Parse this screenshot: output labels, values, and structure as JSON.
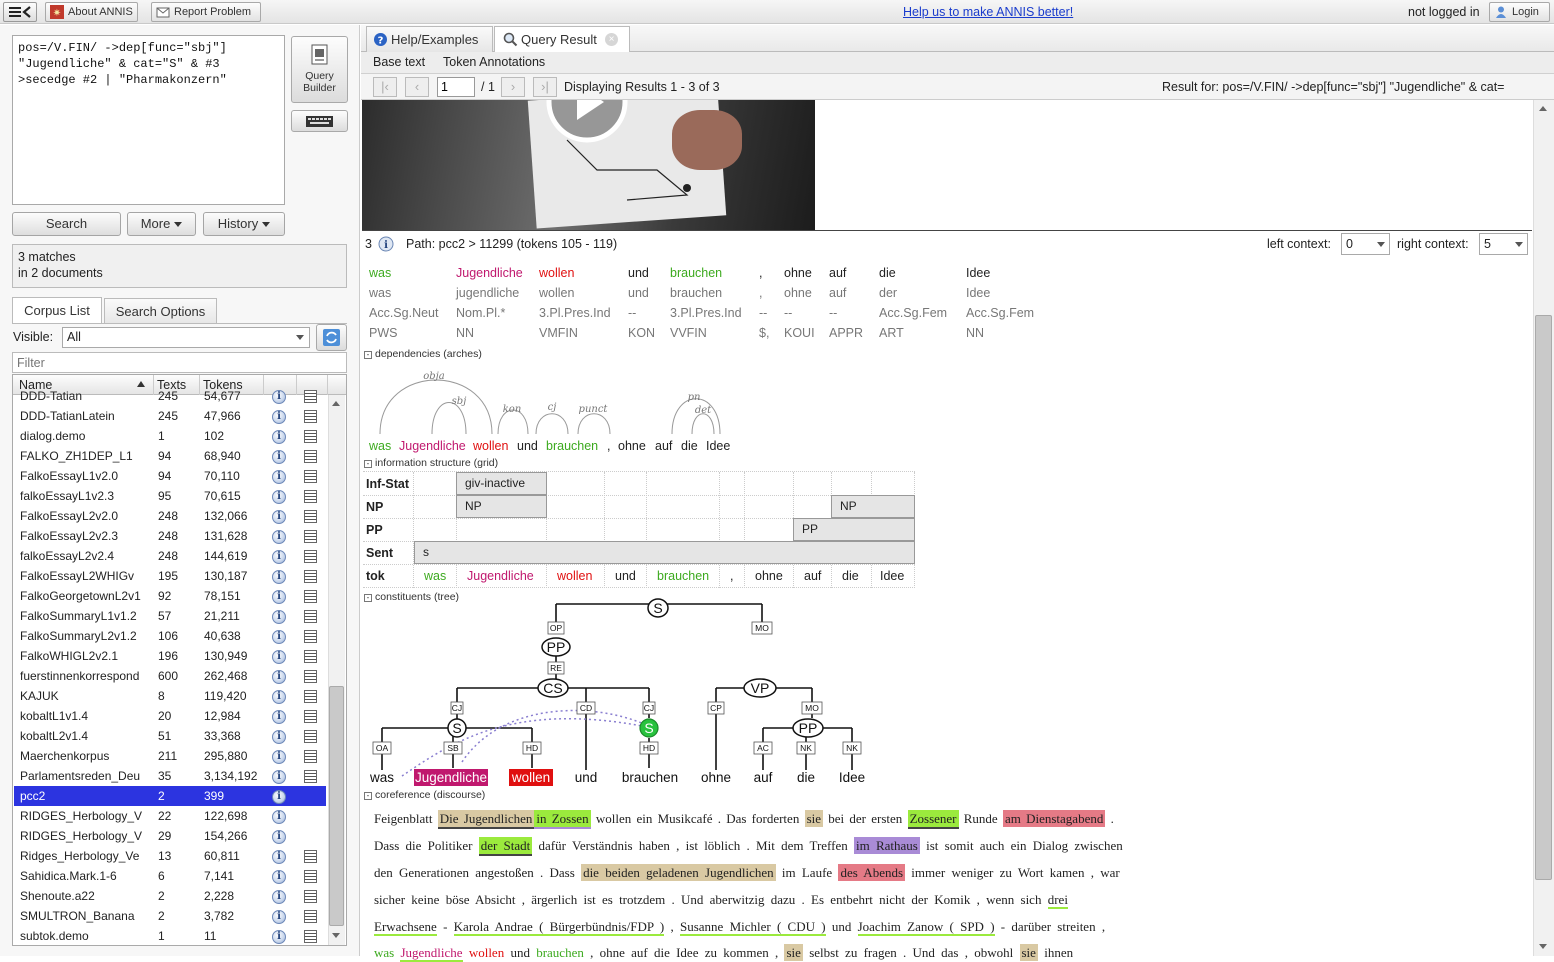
{
  "topbar": {
    "about_label": "About ANNIS",
    "report_label": "Report Problem",
    "help_link": "Help us to make ANNIS better!",
    "login_status": "not logged in",
    "login_label": "Login"
  },
  "query": {
    "lines": [
      "pos=/V.FIN/ ->dep[func=\"sbj\"]",
      "\"Jugendliche\" & cat=\"S\" & #3",
      ">secedge #2 | \"Pharmakonzern\""
    ],
    "builder_label_1": "Query",
    "builder_label_2": "Builder",
    "search_label": "Search",
    "more_label": "More",
    "history_label": "History",
    "status_1": "3 matches",
    "status_2": "in 2 documents"
  },
  "corpus_panel": {
    "tab_corpus": "Corpus List",
    "tab_options": "Search Options",
    "visible_label": "Visible:",
    "visible_value": "All",
    "filter_placeholder": "Filter",
    "col_name": "Name",
    "col_texts": "Texts",
    "col_tokens": "Tokens",
    "rows": [
      {
        "name": "DDD-Tatian",
        "texts": "245",
        "tokens": "54,677"
      },
      {
        "name": "DDD-TatianLatein",
        "texts": "245",
        "tokens": "47,966"
      },
      {
        "name": "dialog.demo",
        "texts": "1",
        "tokens": "102"
      },
      {
        "name": "FALKO_ZH1DEP_L1",
        "texts": "94",
        "tokens": "68,940"
      },
      {
        "name": "FalkoEssayL1v2.0",
        "texts": "94",
        "tokens": "70,110"
      },
      {
        "name": "falkoEssayL1v2.3",
        "texts": "95",
        "tokens": "70,615"
      },
      {
        "name": "FalkoEssayL2v2.0",
        "texts": "248",
        "tokens": "132,066"
      },
      {
        "name": "FalkoEssayL2v2.3",
        "texts": "248",
        "tokens": "131,628"
      },
      {
        "name": "falkoEssayL2v2.4",
        "texts": "248",
        "tokens": "144,619"
      },
      {
        "name": "FalkoEssayL2WHIGv",
        "texts": "195",
        "tokens": "130,187"
      },
      {
        "name": "FalkoGeorgetownL2v1",
        "texts": "92",
        "tokens": "78,151"
      },
      {
        "name": "FalkoSummaryL1v1.2",
        "texts": "57",
        "tokens": "21,211"
      },
      {
        "name": "FalkoSummaryL2v1.2",
        "texts": "106",
        "tokens": "40,638"
      },
      {
        "name": "FalkoWHIGL2v2.1",
        "texts": "196",
        "tokens": "130,949"
      },
      {
        "name": "fuerstinnenkorrespond",
        "texts": "600",
        "tokens": "262,468"
      },
      {
        "name": "KAJUK",
        "texts": "8",
        "tokens": "119,420"
      },
      {
        "name": "kobaltL1v1.4",
        "texts": "20",
        "tokens": "12,984"
      },
      {
        "name": "kobaltL2v1.4",
        "texts": "51",
        "tokens": "33,368"
      },
      {
        "name": "Maerchenkorpus",
        "texts": "211",
        "tokens": "295,880"
      },
      {
        "name": "Parlamentsreden_Deu",
        "texts": "35",
        "tokens": "3,134,192"
      },
      {
        "name": "pcc2",
        "texts": "2",
        "tokens": "399"
      },
      {
        "name": "RIDGES_Herbology_V",
        "texts": "22",
        "tokens": "122,698"
      },
      {
        "name": "RIDGES_Herbology_V",
        "texts": "29",
        "tokens": "154,266"
      },
      {
        "name": "Ridges_Herbology_Ve",
        "texts": "13",
        "tokens": "60,811"
      },
      {
        "name": "Sahidica.Mark.1-6",
        "texts": "6",
        "tokens": "7,141"
      },
      {
        "name": "Shenoute.a22",
        "texts": "2",
        "tokens": "2,228"
      },
      {
        "name": "SMULTRON_Banana",
        "texts": "2",
        "tokens": "3,782"
      },
      {
        "name": "subtok.demo",
        "texts": "1",
        "tokens": "11"
      }
    ]
  },
  "result_tabs": {
    "help": "Help/Examples",
    "result": "Query Result",
    "base_text": "Base text",
    "token_annotations": "Token Annotations"
  },
  "paging": {
    "page": "1",
    "of": "/ 1",
    "displaying": "Displaying Results 1 - 3 of 3",
    "result_for": "Result for: pos=/V.FIN/ ->dep[func=\"sbj\"] \"Jugendliche\" & cat="
  },
  "match": {
    "number": "3",
    "path": "Path: pcc2 > 11299 (tokens 105 - 119)",
    "left_context_label": "left context:",
    "left_context_value": "0",
    "right_context_label": "right context:",
    "right_context_value": "5"
  },
  "tokens": {
    "words": [
      "was",
      "Jugendliche",
      "wollen",
      "und",
      "brauchen",
      ",",
      "ohne",
      "auf",
      "die",
      "Idee"
    ],
    "lemma": [
      "was",
      "jugendliche",
      "wollen",
      "und",
      "brauchen",
      ",",
      "ohne",
      "auf",
      "der",
      "Idee"
    ],
    "morph": [
      "Acc.Sg.Neut",
      "Nom.Pl.*",
      "3.Pl.Pres.Ind",
      "--",
      "3.Pl.Pres.Ind",
      "--",
      "--",
      "--",
      "Acc.Sg.Fem",
      "Acc.Sg.Fem"
    ],
    "pos": [
      "PWS",
      "NN",
      "VMFIN",
      "KON",
      "VVFIN",
      "$,",
      "KOUI",
      "APPR",
      "ART",
      "NN"
    ]
  },
  "sections": {
    "dependencies": "dependencies (arches)",
    "infostruct": "information structure (grid)",
    "constituents": "constituents (tree)",
    "coreference": "coreference (discourse)"
  },
  "dependencies": {
    "labels": [
      "obja",
      "sbj",
      "kon",
      "cj",
      "punct",
      "pn",
      "det"
    ],
    "words": [
      "was",
      "Jugendliche",
      "wollen",
      "und",
      "brauchen",
      ",",
      "ohne",
      "auf",
      "die",
      "Idee"
    ]
  },
  "grid": {
    "row_labels": [
      "Inf-Stat",
      "NP",
      "PP",
      "Sent",
      "tok"
    ],
    "giv": "giv-inactive",
    "np1": "NP",
    "np2": "NP",
    "pp": "PP",
    "sent": "s",
    "tok": [
      "was",
      "Jugendliche",
      "wollen",
      "und",
      "brauchen",
      ",",
      "ohne",
      "auf",
      "die",
      "Idee"
    ]
  },
  "tree": {
    "nodes": {
      "s_top": "S",
      "pp1": "PP",
      "cs": "CS",
      "vp": "VP",
      "s_low": "S",
      "s_green": "S",
      "pp2": "PP"
    },
    "edges": {
      "op": "OP",
      "mo1": "MO",
      "re": "RE",
      "cj1": "CJ",
      "cd": "CD",
      "cj2": "CJ",
      "cp": "CP",
      "mo2": "MO",
      "oa": "OA",
      "sb": "SB",
      "hd1": "HD",
      "hd2": "HD",
      "ac": "AC",
      "nk1": "NK",
      "nk2": "NK",
      "cj3": "CJ"
    },
    "leaves": [
      "was",
      "Jugendliche",
      "wollen",
      "und",
      "brauchen",
      "ohne",
      "auf",
      "die",
      "Idee"
    ]
  },
  "coref": {
    "l1": [
      "Feigenblatt",
      "Die Jugendlichen",
      "in Zossen",
      "wollen ein Musikcafé . Das forderten",
      "sie",
      "bei der ersten",
      "Zossener",
      "Runde",
      "am Dienstagabend",
      "."
    ],
    "l2": [
      "Dass die Politiker",
      "der Stadt",
      "dafür Verständnis haben , ist löblich . Mit dem Treffen",
      "im Rathaus",
      "ist somit auch ein Dialog zwischen"
    ],
    "l3": [
      "den Generationen angestoßen . Dass",
      "die beiden geladenen Jugendlichen",
      "im Laufe",
      "des Abends",
      "immer weniger zu Wort kamen , war"
    ],
    "l4": [
      "sicher keine böse Absicht , ärgerlich ist es trotzdem . Und aberwitzig dazu . Es entbehrt nicht der Komik , wenn sich",
      "drei"
    ],
    "l5": [
      "Erwachsene",
      "-",
      "Karola Andrae ( Bürgerbündnis/FDP )",
      ",",
      "Susanne Michler ( CDU )",
      "und",
      "Joachim Zanow ( SPD )",
      "- darüber streiten ,"
    ],
    "l6": [
      "was",
      "Jugendliche",
      "wollen",
      "und",
      "brauchen",
      ", ohne auf die Idee zu kommen ,",
      "sie",
      "selbst zu fragen . Und das , obwohl",
      "sie",
      "ihnen"
    ]
  },
  "colors": {
    "green": "#3daa1f",
    "magenta": "#c0186e",
    "red": "#e01010",
    "selected": "#2c34e0"
  }
}
